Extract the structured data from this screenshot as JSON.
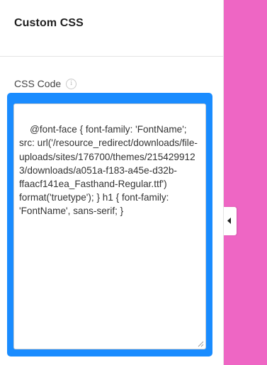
{
  "panel": {
    "title": "Custom CSS"
  },
  "css_field": {
    "label": "CSS Code",
    "info_icon": "info-icon",
    "value": "@font-face { font-family: 'FontName'; src: url('/resource_redirect/downloads/file-uploads/sites/176700/themes/2154299123/downloads/a051a-f183-a45e-d32b-ffaacf141ea_Fasthand-Regular.ttf') format('truetype'); } h1 { font-family: 'FontName', sans-serif; }"
  },
  "collapse_toggle": {
    "icon": "chevron-left-icon"
  },
  "colors": {
    "focus_ring": "#1a8cff",
    "preview_background": "#ee66c4"
  }
}
